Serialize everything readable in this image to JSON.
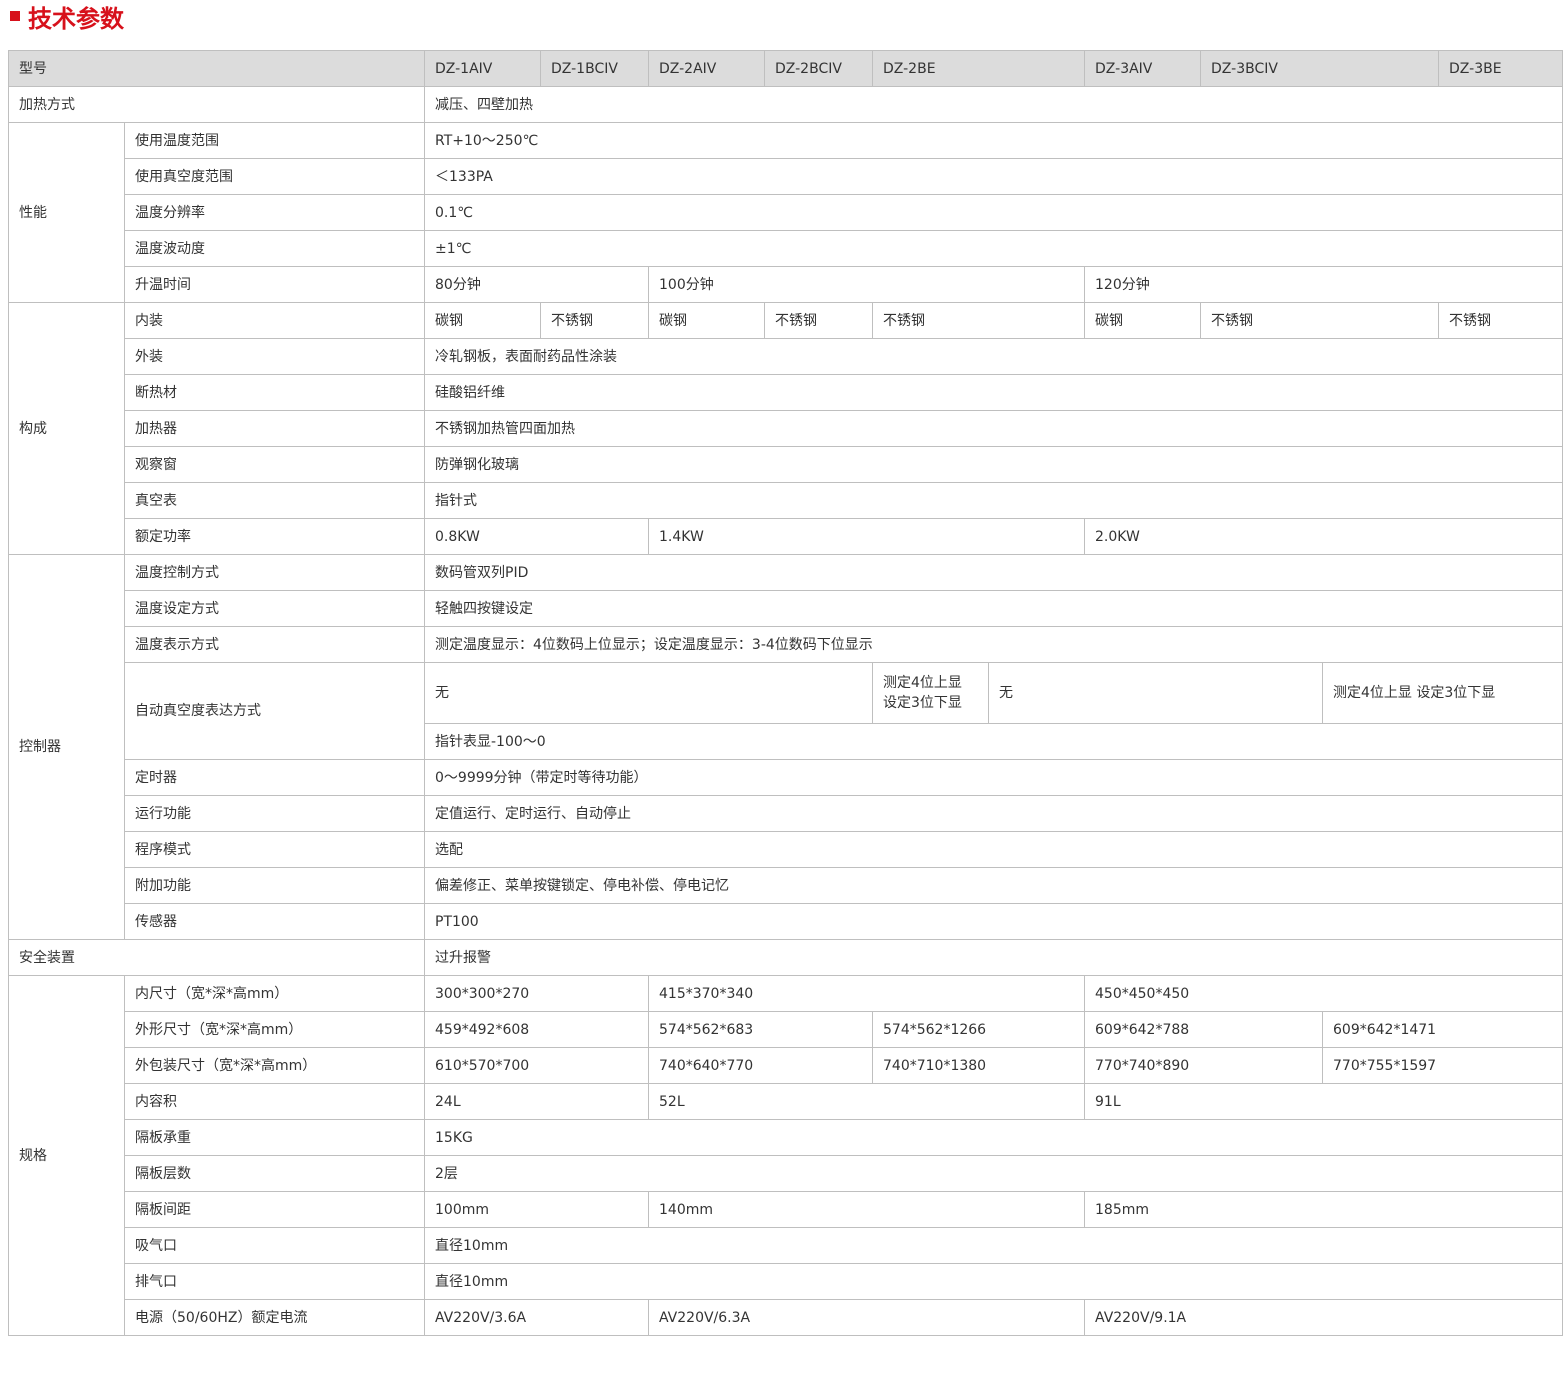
{
  "title": "技术参数",
  "colors": {
    "accent": "#d7111b",
    "header_bg": "#dcdcdc",
    "border": "#bfbfbf",
    "text": "#333333"
  },
  "header": {
    "label": "型号",
    "models": [
      "DZ-1AIV",
      "DZ-1BCIV",
      "DZ-2AIV",
      "DZ-2BCIV",
      "DZ-2BE",
      "DZ-3AIV",
      "DZ-3BCIV",
      "DZ-3BE"
    ]
  },
  "heating_method": {
    "label": "加热方式",
    "value": "减压、四壁加热"
  },
  "performance": {
    "label": "性能",
    "temp_range": {
      "label": "使用温度范围",
      "value": "RT+10～250℃"
    },
    "vacuum_range": {
      "label": "使用真空度范围",
      "value": "＜133PA"
    },
    "temp_resolution": {
      "label": "温度分辨率",
      "value": "0.1℃"
    },
    "temp_fluctuation": {
      "label": "温度波动度",
      "value": "±1℃"
    },
    "heat_up_time": {
      "label": "升温时间",
      "values": [
        "80分钟",
        "100分钟",
        "120分钟"
      ]
    }
  },
  "construction": {
    "label": "构成",
    "interior": {
      "label": "内装",
      "values": [
        "碳钢",
        "不锈钢",
        "碳钢",
        "不锈钢",
        "不锈钢",
        "碳钢",
        "不锈钢",
        "不锈钢"
      ]
    },
    "exterior": {
      "label": "外装",
      "value": "冷轧钢板，表面耐药品性涂装"
    },
    "insulation": {
      "label": "断热材",
      "value": "硅酸铝纤维"
    },
    "heater": {
      "label": "加热器",
      "value": "不锈钢加热管四面加热"
    },
    "window": {
      "label": "观察窗",
      "value": "防弹钢化玻璃"
    },
    "vacuum_gauge": {
      "label": "真空表",
      "value": "指针式"
    },
    "rated_power": {
      "label": "额定功率",
      "values": [
        "0.8KW",
        "1.4KW",
        "2.0KW"
      ]
    }
  },
  "controller": {
    "label": "控制器",
    "temp_control": {
      "label": "温度控制方式",
      "value": "数码管双列PID"
    },
    "temp_setting": {
      "label": "温度设定方式",
      "value": "轻触四按键设定"
    },
    "temp_display": {
      "label": "温度表示方式",
      "value": "测定温度显示：4位数码上位显示；设定温度显示：3-4位数码下位显示"
    },
    "vacuum_display": {
      "label": "自动真空度表达方式",
      "values": [
        "无",
        "测定4位上显",
        "设定3位下显",
        "无",
        "测定4位上显 设定3位下显"
      ],
      "pointer": "指针表显-100～0"
    },
    "timer": {
      "label": "定时器",
      "value": "0～9999分钟（带定时等待功能）"
    },
    "run_function": {
      "label": "运行功能",
      "value": "定值运行、定时运行、自动停止"
    },
    "program_mode": {
      "label": "程序模式",
      "value": "选配"
    },
    "extra_function": {
      "label": "附加功能",
      "value": "偏差修正、菜单按键锁定、停电补偿、停电记忆"
    },
    "sensor": {
      "label": "传感器",
      "value": "PT100"
    }
  },
  "safety": {
    "label": "安全装置",
    "value": "过升报警"
  },
  "specs": {
    "label": "规格",
    "inner_size": {
      "label": "内尺寸（宽*深*高mm）",
      "values": [
        "300*300*270",
        "415*370*340",
        "450*450*450"
      ]
    },
    "outer_size": {
      "label": "外形尺寸（宽*深*高mm）",
      "values": [
        "459*492*608",
        "574*562*683",
        "574*562*1266",
        "609*642*788",
        "609*642*1471"
      ]
    },
    "package_size": {
      "label": "外包装尺寸（宽*深*高mm）",
      "values": [
        "610*570*700",
        "740*640*770",
        "740*710*1380",
        "770*740*890",
        "770*755*1597"
      ]
    },
    "volume": {
      "label": "内容积",
      "values": [
        "24L",
        "52L",
        "91L"
      ]
    },
    "shelf_load": {
      "label": "隔板承重",
      "value": "15KG"
    },
    "shelf_layers": {
      "label": "隔板层数",
      "value": "2层"
    },
    "shelf_spacing": {
      "label": "隔板间距",
      "values": [
        "100mm",
        "140mm",
        "185mm"
      ]
    },
    "intake": {
      "label": "吸气口",
      "value": "直径10mm"
    },
    "exhaust": {
      "label": "排气口",
      "value": "直径10mm"
    },
    "power_supply": {
      "label": "电源（50/60HZ）额定电流",
      "values": [
        "AV220V/3.6A",
        "AV220V/6.3A",
        "AV220V/9.1A"
      ]
    }
  }
}
